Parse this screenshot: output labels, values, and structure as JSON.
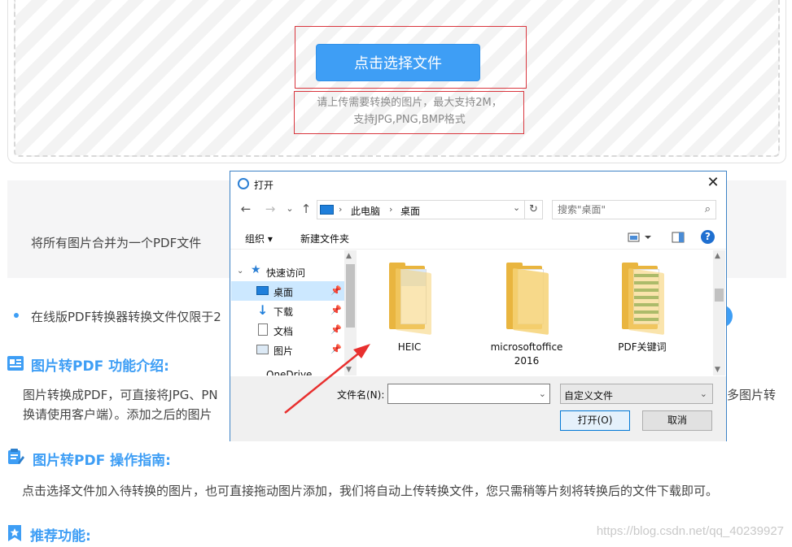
{
  "upload": {
    "button_label": "点击选择文件",
    "hint_line1": "请上传需要转换的图片，最大支持2M，",
    "hint_line2": "支持JPG,PNG,BMP格式"
  },
  "merge": {
    "text": "将所有图片合并为一个PDF文件"
  },
  "notice": {
    "text": "在线版PDF转换器转换文件仅限于2"
  },
  "sections": {
    "intro": {
      "title": "图片转PDF 功能介绍:",
      "line1_left": "图片转换成PDF，可直接将JPG、PN",
      "line1_right": "多图片转",
      "line2_left": "换请使用客户端）。添加之后的图片"
    },
    "guide": {
      "title": "图片转PDF 操作指南:",
      "text": "点击选择文件加入待转换的图片，也可直接拖动图片添加，我们将自动上传转换文件，您只需稍等片刻将转换后的文件下载即可。"
    },
    "recommend": {
      "title": "推荐功能:"
    }
  },
  "watermark": "https://blog.csdn.net/qq_40239927",
  "dialog": {
    "title": "打开",
    "close": "✕",
    "nav": {
      "back": "←",
      "forward": "→",
      "recent": "⌄",
      "up": "↑"
    },
    "address": {
      "items": [
        "此电脑",
        "桌面"
      ],
      "separator": "›",
      "dropdown": "⌄",
      "refresh": "↻"
    },
    "search": {
      "placeholder": "搜索\"桌面\""
    },
    "toolbar": {
      "organize": "组织 ▾",
      "new_folder": "新建文件夹",
      "help": "?"
    },
    "nav_pane": {
      "quick_access": "快速访问",
      "items": [
        {
          "label": "桌面",
          "pin": "📌"
        },
        {
          "label": "下载",
          "pin": "📌"
        },
        {
          "label": "文档",
          "pin": "📌"
        },
        {
          "label": "图片",
          "pin": "📌"
        }
      ],
      "partial": "OneDrive"
    },
    "files": [
      {
        "name": "HEIC"
      },
      {
        "name": "microsoftoffice 2016"
      },
      {
        "name": "PDF关键词"
      }
    ],
    "bottom": {
      "filename_label": "文件名(N):",
      "filename_value": "",
      "filetype": "自定义文件",
      "open_button": "打开(O)",
      "cancel_button": "取消"
    }
  }
}
